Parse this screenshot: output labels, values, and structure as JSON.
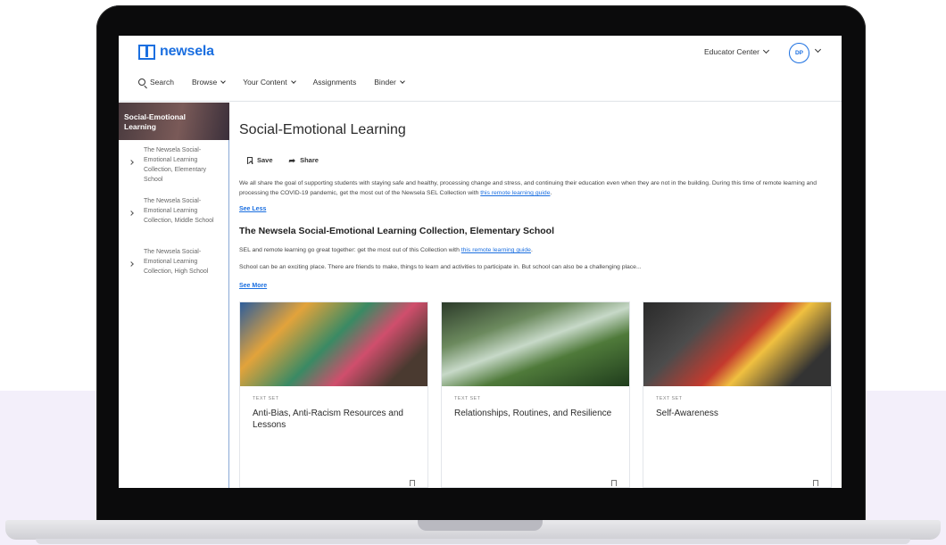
{
  "header": {
    "logo_text": "newsela",
    "educator_center": "Educator Center",
    "avatar_initials": "DP"
  },
  "nav": {
    "search": "Search",
    "browse": "Browse",
    "your_content": "Your Content",
    "assignments": "Assignments",
    "binder": "Binder"
  },
  "sidebar": {
    "hero_title": "Social-Emotional Learning",
    "items": [
      {
        "label": "The Newsela Social-Emotional Learning Collection, Elementary School"
      },
      {
        "label": "The Newsela Social-Emotional Learning Collection, Middle School"
      },
      {
        "label": "The Newsela Social-Emotional Learning Collection, High School"
      }
    ]
  },
  "main": {
    "title": "Social-Emotional Learning",
    "save_label": "Save",
    "share_label": "Share",
    "description": "We all share the goal of supporting students with staying safe and healthy, processing change and stress, and continuing their education even when they are not in the building. During this time of remote learning and processing the COVID-19 pandemic, get the most out of the Newsela SEL Collection with",
    "description_link": "this remote learning guide",
    "see_less": "See Less",
    "section_title": "The Newsela Social-Emotional Learning Collection, Elementary School",
    "section_p1": "SEL and remote learning go great together: get the most out of this Collection with",
    "section_p1_link": "this remote learning guide",
    "section_p2": "School can be an exciting place. There are friends to make, things to learn and activities to participate in. But school can also be a challenging place...",
    "see_more": "See More"
  },
  "cards": [
    {
      "kicker": "TEXT SET",
      "title": "Anti-Bias, Anti-Racism Resources and Lessons"
    },
    {
      "kicker": "TEXT SET",
      "title": "Relationships, Routines, and Resilience"
    },
    {
      "kicker": "TEXT SET",
      "title": "Self-Awareness"
    }
  ],
  "colors": {
    "brand": "#1b6fe0",
    "lavender_band": "#f3effa",
    "laptop_bezel": "#0b0b0c"
  }
}
